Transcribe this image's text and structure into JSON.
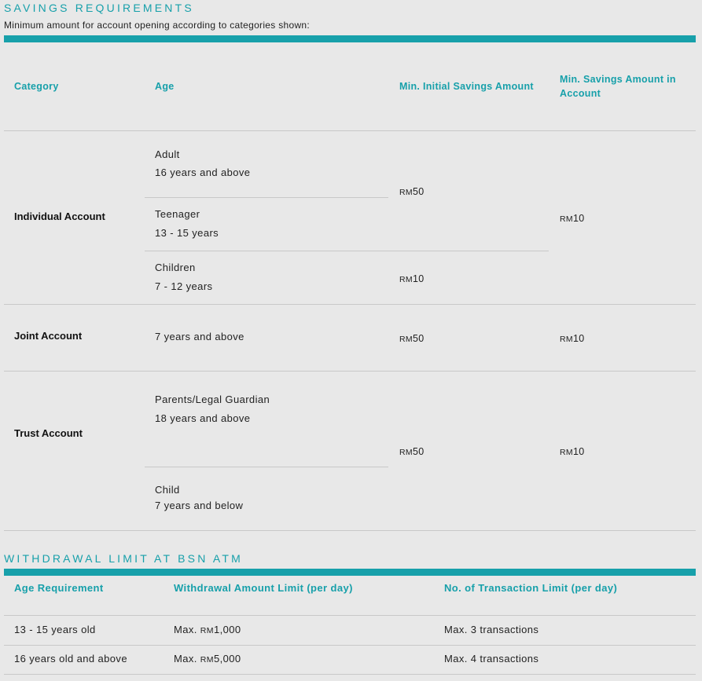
{
  "savings": {
    "title": "SAVINGS REQUIREMENTS",
    "subtitle": "Minimum amount for account opening according to categories shown:",
    "headers": {
      "category": "Category",
      "age": "Age",
      "min_initial": "Min. Initial Savings Amount",
      "min_savings": "Min. Savings Amount in Account"
    },
    "individual": {
      "category": "Individual Account",
      "adult_label": "Adult",
      "adult_age": "16 years and above",
      "teen_label": "Teenager",
      "teen_age": "13 - 15 years",
      "child_label": "Children",
      "child_age": "7 - 12 years",
      "initial_adult_teen_cur": "RM",
      "initial_adult_teen_val": "50",
      "initial_child_cur": "RM",
      "initial_child_val": "10",
      "min_savings_cur": "RM",
      "min_savings_val": "10"
    },
    "joint": {
      "category": "Joint Account",
      "age": "7 years and above",
      "initial_cur": "RM",
      "initial_val": "50",
      "min_savings_cur": "RM",
      "min_savings_val": "10"
    },
    "trust": {
      "category": "Trust Account",
      "parent_label": "Parents/Legal Guardian",
      "parent_age": "18 years and above",
      "child_label": "Child",
      "child_age": "7 years and below",
      "initial_cur": "RM",
      "initial_val": "50",
      "min_savings_cur": "RM",
      "min_savings_val": "10"
    }
  },
  "withdrawal": {
    "title": "WITHDRAWAL LIMIT AT BSN ATM",
    "headers": {
      "age": "Age Requirement",
      "amount": "Withdrawal Amount Limit (per day)",
      "transactions": "No. of Transaction Limit (per day)"
    },
    "rows": [
      {
        "age": "13 - 15 years old",
        "amount_prefix": "Max. ",
        "amount_cur": "RM",
        "amount_val": "1,000",
        "transactions": "Max. 3 transactions"
      },
      {
        "age": "16 years old and above",
        "amount_prefix": "Max. ",
        "amount_cur": "RM",
        "amount_val": "5,000",
        "transactions": "Max. 4 transactions"
      }
    ]
  },
  "colors": {
    "accent": "#17a0aa",
    "background": "#e8e8e8"
  }
}
